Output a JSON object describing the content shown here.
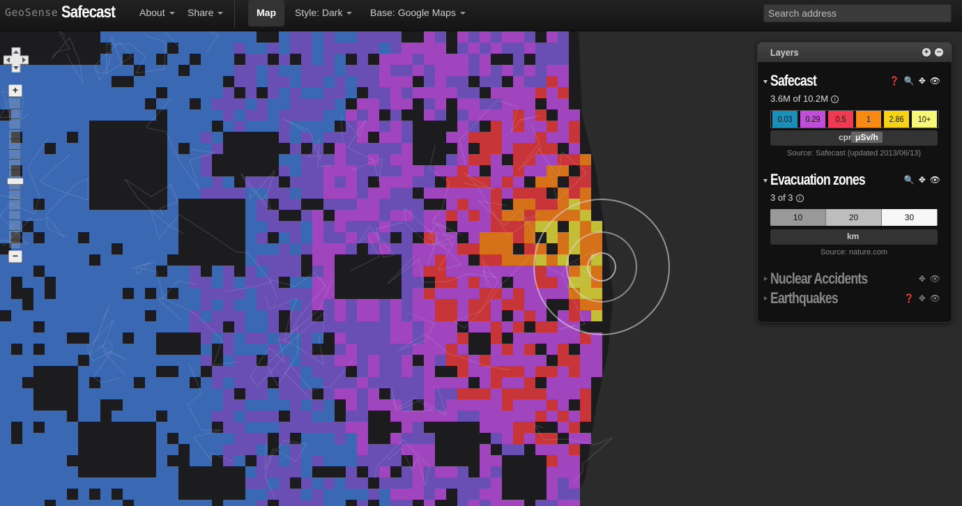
{
  "nav": {
    "brand_small": "GeoSense",
    "brand": "Safecast",
    "about": "About",
    "share": "Share",
    "map": "Map",
    "style": "Style: Dark",
    "base": "Base: Google Maps",
    "search_placeholder": "Search address"
  },
  "zoom": {
    "plus": "+",
    "minus": "−"
  },
  "panel": {
    "title": "Layers",
    "safecast": {
      "title": "Safecast",
      "count": "3.6M of 10.2M",
      "legend": [
        {
          "label": "0.03",
          "color": "#1a8fb8"
        },
        {
          "label": "0.29",
          "color": "#c04ed8"
        },
        {
          "label": "0.5",
          "color": "#ee3a52"
        },
        {
          "label": "1",
          "color": "#f58a16"
        },
        {
          "label": "2.86",
          "color": "#f5d418"
        },
        {
          "label": "10+",
          "color": "#f7f77a"
        }
      ],
      "unit_cpm": "cpm",
      "unit_usv": "μSv/h",
      "source": "Source: Safecast (updated 2013/06/13)"
    },
    "evac": {
      "title": "Evacuation zones",
      "count": "3 of 3",
      "zones": [
        {
          "label": "10",
          "color": "#999999"
        },
        {
          "label": "20",
          "color": "#bdbdbd"
        },
        {
          "label": "30",
          "color": "#f7f7f7"
        }
      ],
      "unit": "km",
      "source": "Source: nature.com"
    },
    "nuclear": {
      "title": "Nuclear Accidents"
    },
    "quakes": {
      "title": "Earthquakes"
    }
  },
  "colors": {
    "blue": "#3f73c8",
    "purple": "#7455c8",
    "magenta": "#b44bd6",
    "red": "#e0393c",
    "orange": "#ef7d18",
    "yellow": "#dcd53b",
    "land": "#1c1c1e",
    "sea": "#2b2b2c"
  }
}
